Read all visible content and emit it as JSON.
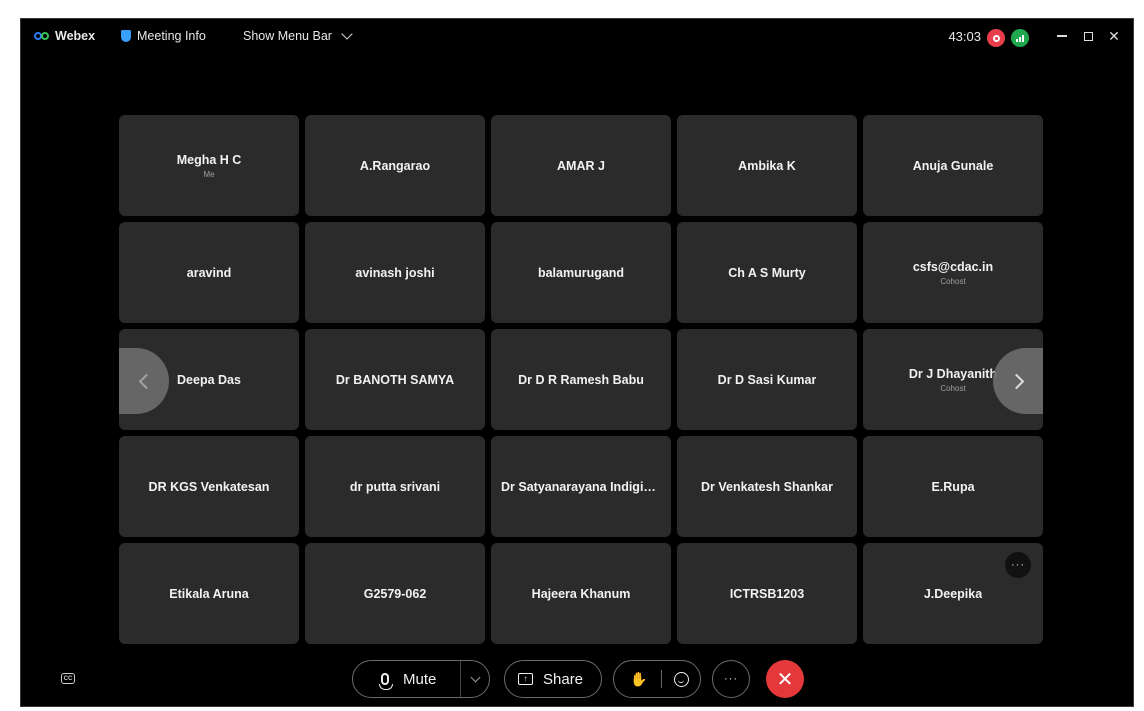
{
  "titlebar": {
    "app_name": "Webex",
    "meeting_info": "Meeting Info",
    "show_menu_bar": "Show Menu Bar",
    "timer": "43:03"
  },
  "participants": [
    {
      "name": "Megha H C",
      "sub": "Me"
    },
    {
      "name": "A.Rangarao",
      "sub": ""
    },
    {
      "name": "AMAR J",
      "sub": ""
    },
    {
      "name": "Ambika K",
      "sub": ""
    },
    {
      "name": "Anuja Gunale",
      "sub": ""
    },
    {
      "name": "aravind",
      "sub": ""
    },
    {
      "name": "avinash joshi",
      "sub": ""
    },
    {
      "name": "balamurugand",
      "sub": ""
    },
    {
      "name": "Ch A S Murty",
      "sub": ""
    },
    {
      "name": "csfs@cdac.in",
      "sub": "Cohost"
    },
    {
      "name": "Deepa Das",
      "sub": ""
    },
    {
      "name": "Dr BANOTH SAMYA",
      "sub": ""
    },
    {
      "name": "Dr D R Ramesh Babu",
      "sub": ""
    },
    {
      "name": "Dr D Sasi Kumar",
      "sub": ""
    },
    {
      "name": "Dr J Dhayanith",
      "sub": "Cohost"
    },
    {
      "name": "DR KGS Venkatesan",
      "sub": ""
    },
    {
      "name": "dr putta srivani",
      "sub": ""
    },
    {
      "name": "Dr Satyanarayana Indigib...",
      "sub": ""
    },
    {
      "name": "Dr Venkatesh Shankar",
      "sub": ""
    },
    {
      "name": "E.Rupa",
      "sub": ""
    },
    {
      "name": "Etikala Aruna",
      "sub": ""
    },
    {
      "name": "G2579-062",
      "sub": ""
    },
    {
      "name": "Hajeera Khanum",
      "sub": ""
    },
    {
      "name": "ICTRSB1203",
      "sub": ""
    },
    {
      "name": "J.Deepika",
      "sub": ""
    }
  ],
  "controls": {
    "mute_label": "Mute",
    "share_label": "Share",
    "more_label": "···",
    "tile_more_label": "···",
    "cc_label": "CC",
    "leave_label": "✕"
  },
  "colors": {
    "background": "#000000",
    "tile": "#2b2b2b",
    "leave": "#e5383b",
    "recording": "#e83d4a",
    "stats": "#1fa84d"
  }
}
